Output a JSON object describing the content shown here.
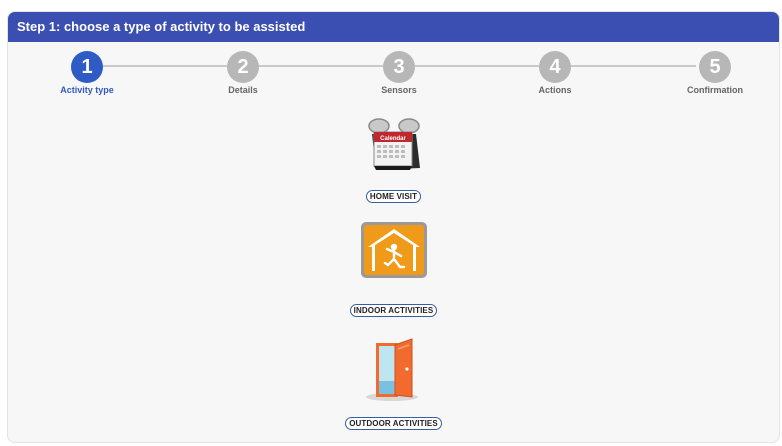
{
  "header": {
    "title": "Step 1: choose a type of activity to be assisted"
  },
  "stepper": {
    "steps": [
      {
        "number": "1",
        "label": "Activity type",
        "active": true
      },
      {
        "number": "2",
        "label": "Details",
        "active": false
      },
      {
        "number": "3",
        "label": "Sensors",
        "active": false
      },
      {
        "number": "4",
        "label": "Actions",
        "active": false
      },
      {
        "number": "5",
        "label": "Confirmation",
        "active": false
      }
    ]
  },
  "activities": {
    "home": {
      "label": "HOME VISIT",
      "icon": "calendar-icon",
      "icon_text": "Calendar"
    },
    "indoor": {
      "label": "INDOOR ACTIVITIES",
      "icon": "indoor-house-icon"
    },
    "outdoor": {
      "label": "OUTDOOR ACTIVITIES",
      "icon": "open-door-icon"
    }
  },
  "colors": {
    "header": "#3b4fb2",
    "active_step": "#2f5bc4",
    "inactive_step": "#b7b7b7",
    "indoor_orange": "#f09a1a",
    "door_orange": "#f26a2e"
  }
}
